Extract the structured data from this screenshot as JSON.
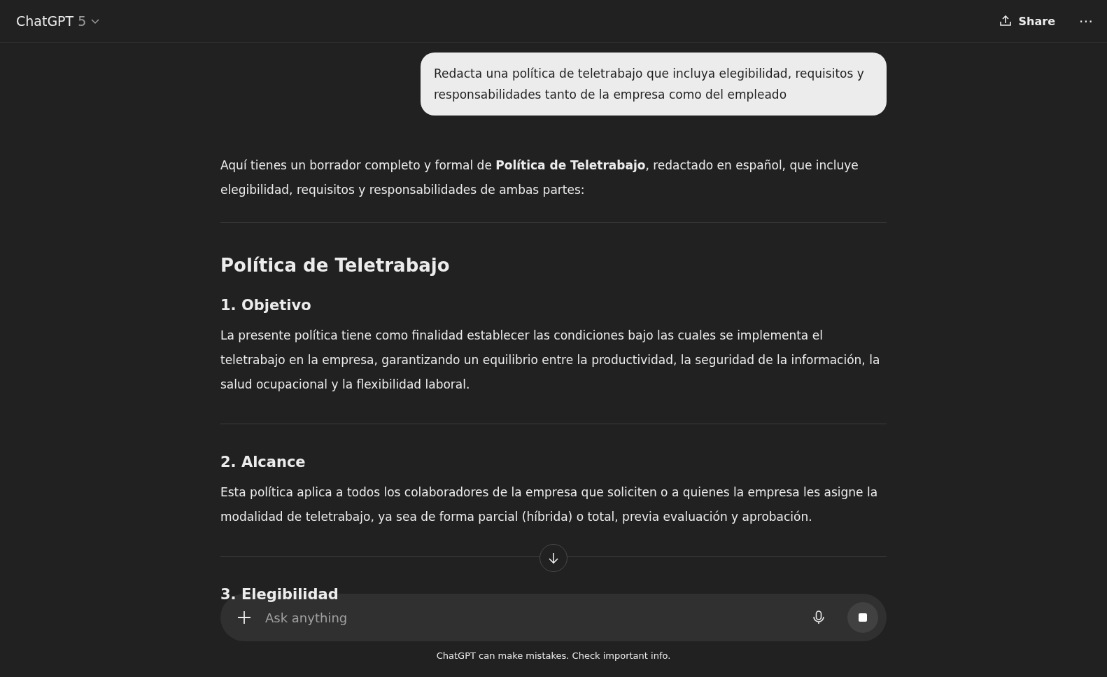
{
  "header": {
    "title": "ChatGPT",
    "model": "5",
    "share": "Share",
    "more": "⋯"
  },
  "user_message": "Redacta una política de teletrabajo que incluya elegibilidad, requisitos y responsabilidades tanto de la empresa como del empleado",
  "response": {
    "intro": "Aquí tienes un borrador completo y formal de **Política de Teletrabajo**, redactado en español, que incluye elegibilidad, requisitos y responsabilidades de ambas partes:",
    "title": "Política de Teletrabajo",
    "sections": [
      {
        "heading": "1. Objetivo",
        "text": "La presente política tiene como finalidad establecer las condiciones bajo las cuales se implementa el teletrabajo en la empresa, garantizando un equilibrio entre la productividad, la seguridad de la información, la salud ocupacional y la flexibilidad laboral."
      },
      {
        "heading": "2. Alcance",
        "text": "Esta política aplica a todos los colaboradores de la empresa que soliciten o a quienes la empresa les asigne la modalidad de teletrabajo, ya sea de forma parcial (híbrida) o total, previa evaluación y aprobación."
      },
      {
        "heading": "3. Elegibilidad"
      }
    ]
  },
  "composer": {
    "placeholder": "Ask anything"
  },
  "disclaimer": "ChatGPT can make mistakes. Check important info."
}
